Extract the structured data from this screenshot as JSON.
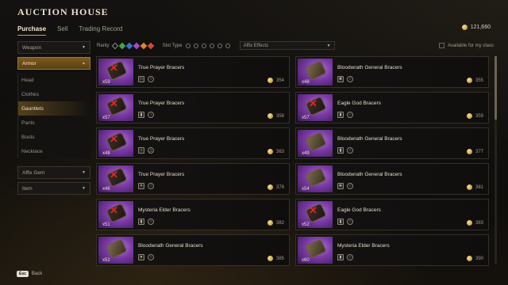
{
  "title": "AUCTION HOUSE",
  "tabs": [
    {
      "label": "Purchase",
      "active": true
    },
    {
      "label": "Sell",
      "active": false
    },
    {
      "label": "Trading Record",
      "active": false
    }
  ],
  "currency": {
    "amount": "121,660",
    "icon": "gold-coin-icon"
  },
  "sidebar": {
    "weapon_label": "Weapon",
    "armor_label": "Armor",
    "armor_items": [
      {
        "label": "Head"
      },
      {
        "label": "Clothes"
      },
      {
        "label": "Gauntlets",
        "active": true
      },
      {
        "label": "Pants"
      },
      {
        "label": "Boots"
      },
      {
        "label": "Necklace"
      }
    ],
    "affix_gem_label": "Affix Gem",
    "item_label": "Item"
  },
  "filters": {
    "rarity_label": "Rarity",
    "slot_type_label": "Slot Type",
    "affix_effects_label": "Affix Effects",
    "available_label": "Available for my class",
    "rarity_colors": [
      "#8a8a8a",
      "#3fa64a",
      "#3d6fd1",
      "#9b4fd0",
      "#d88a2a",
      "#d24a3a"
    ]
  },
  "items": [
    {
      "name": "True Prayer Bracers",
      "qty": "x59",
      "price": "354",
      "icons": [
        "□",
        "○"
      ]
    },
    {
      "name": "Bloodwrath General Bracers",
      "qty": "x48",
      "price": "355",
      "icons": [
        "✖",
        "○"
      ]
    },
    {
      "name": "True Prayer Bracers",
      "qty": "x57",
      "price": "358",
      "icons": [
        "▮",
        "○"
      ]
    },
    {
      "name": "Eagle God Bracers",
      "qty": "x57",
      "price": "359",
      "icons": [
        "▮",
        "○"
      ]
    },
    {
      "name": "True Prayer Bracers",
      "qty": "x48",
      "price": "363",
      "icons": [
        "○",
        "△"
      ]
    },
    {
      "name": "Bloodwrath General Bracers",
      "qty": "x49",
      "price": "377",
      "icons": [
        "▮",
        "○"
      ]
    },
    {
      "name": "True Prayer Bracers",
      "qty": "x46",
      "price": "378",
      "icons": [
        "✶",
        "○"
      ]
    },
    {
      "name": "Bloodwrath General Bracers",
      "qty": "x54",
      "price": "381",
      "icons": [
        "✚",
        "○"
      ]
    },
    {
      "name": "Mysteria Elder Bracers",
      "qty": "x51",
      "price": "382",
      "icons": [
        "▮",
        "○"
      ]
    },
    {
      "name": "Eagle God Bracers",
      "qty": "x52",
      "price": "383",
      "icons": [
        "▮",
        "○"
      ]
    },
    {
      "name": "Bloodwrath General Bracers",
      "qty": "x52",
      "price": "385",
      "icons": [
        "♥",
        "○"
      ]
    },
    {
      "name": "Mysteria Elder Bracers",
      "qty": "x60",
      "price": "390",
      "icons": [
        "▮",
        "○"
      ]
    }
  ],
  "footer": {
    "key": "Esc",
    "label": "Back"
  }
}
